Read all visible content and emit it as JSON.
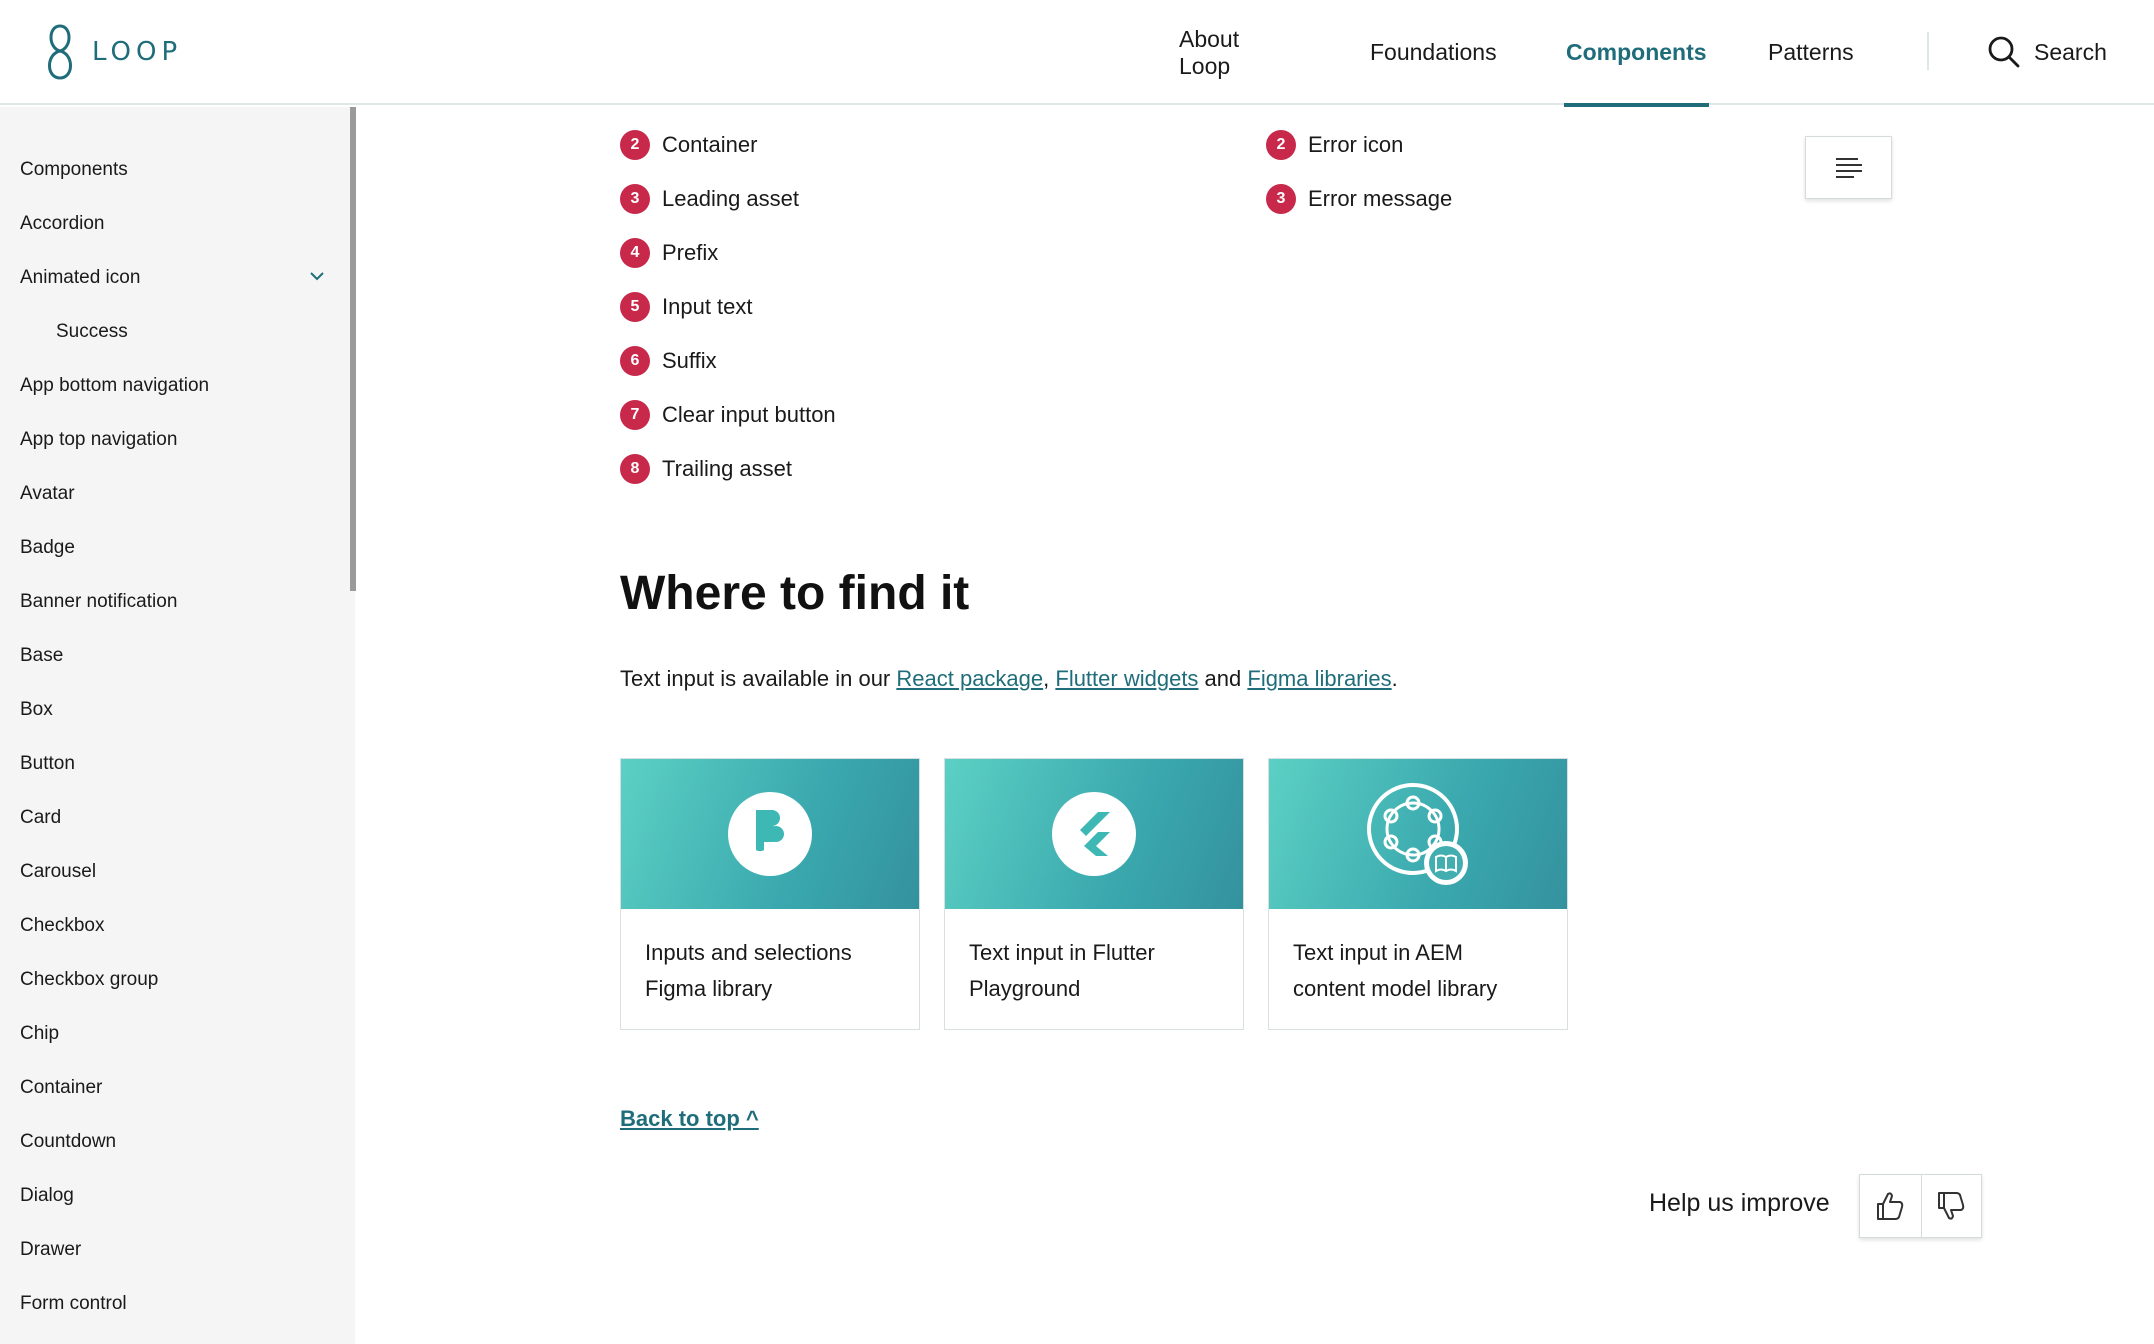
{
  "header": {
    "logo_text": "LOOP",
    "nav": [
      {
        "label": "About Loop",
        "active": false
      },
      {
        "label": "Foundations",
        "active": false
      },
      {
        "label": "Components",
        "active": true
      },
      {
        "label": "Patterns",
        "active": false
      }
    ],
    "search_label": "Search",
    "accent_color": "#1f6d7a"
  },
  "sidebar": {
    "items": [
      {
        "label": "Components"
      },
      {
        "label": "Accordion"
      },
      {
        "label": "Animated icon",
        "expanded": true
      },
      {
        "label": "Success",
        "sub": true
      },
      {
        "label": "App bottom navigation"
      },
      {
        "label": "App top navigation"
      },
      {
        "label": "Avatar"
      },
      {
        "label": "Badge"
      },
      {
        "label": "Banner notification"
      },
      {
        "label": "Base"
      },
      {
        "label": "Box"
      },
      {
        "label": "Button"
      },
      {
        "label": "Card"
      },
      {
        "label": "Carousel"
      },
      {
        "label": "Checkbox"
      },
      {
        "label": "Checkbox group"
      },
      {
        "label": "Chip"
      },
      {
        "label": "Container"
      },
      {
        "label": "Countdown"
      },
      {
        "label": "Dialog"
      },
      {
        "label": "Drawer"
      },
      {
        "label": "Form control"
      }
    ]
  },
  "anatomy": {
    "left": [
      {
        "num": "2",
        "label": "Container"
      },
      {
        "num": "3",
        "label": "Leading asset"
      },
      {
        "num": "4",
        "label": "Prefix"
      },
      {
        "num": "5",
        "label": "Input text"
      },
      {
        "num": "6",
        "label": "Suffix"
      },
      {
        "num": "7",
        "label": "Clear input button"
      },
      {
        "num": "8",
        "label": "Trailing asset"
      }
    ],
    "right": [
      {
        "num": "2",
        "label": "Error icon"
      },
      {
        "num": "3",
        "label": "Error message"
      }
    ],
    "badge_color": "#c8294a"
  },
  "where": {
    "heading": "Where to find it",
    "text_before": "Text input is available in our ",
    "link1": "React package",
    "sep1": ", ",
    "link2": "Flutter widgets",
    "sep2": " and ",
    "link3": "Figma libraries",
    "text_after": "."
  },
  "cards": [
    {
      "icon": "figma-icon",
      "line1": "Inputs and selections",
      "line2": "Figma library"
    },
    {
      "icon": "flutter-icon",
      "line1": "Text input in Flutter",
      "line2": "Playground"
    },
    {
      "icon": "aem-library-icon",
      "line1": "Text input in AEM",
      "line2": "content model library"
    }
  ],
  "back_to_top": "Back to top ^",
  "feedback": {
    "label": "Help us improve",
    "up_icon": "thumbs-up-icon",
    "down_icon": "thumbs-down-icon"
  }
}
